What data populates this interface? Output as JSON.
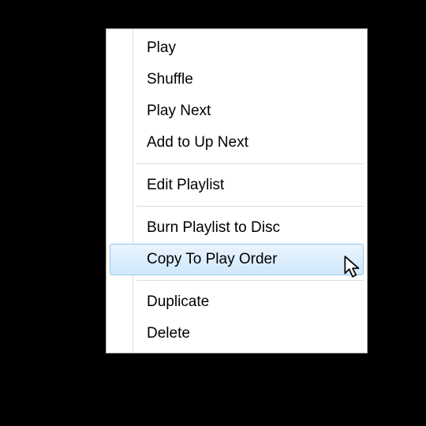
{
  "menu": {
    "groups": [
      {
        "items": [
          {
            "id": "play",
            "label": "Play"
          },
          {
            "id": "shuffle",
            "label": "Shuffle"
          },
          {
            "id": "play-next",
            "label": "Play Next"
          },
          {
            "id": "add-to-up-next",
            "label": "Add to Up Next"
          }
        ]
      },
      {
        "items": [
          {
            "id": "edit-playlist",
            "label": "Edit Playlist"
          }
        ]
      },
      {
        "items": [
          {
            "id": "burn-playlist-to-disc",
            "label": "Burn Playlist to Disc"
          },
          {
            "id": "copy-to-play-order",
            "label": "Copy To Play Order",
            "highlighted": true
          }
        ]
      },
      {
        "items": [
          {
            "id": "duplicate",
            "label": "Duplicate"
          },
          {
            "id": "delete",
            "label": "Delete"
          }
        ]
      }
    ]
  }
}
